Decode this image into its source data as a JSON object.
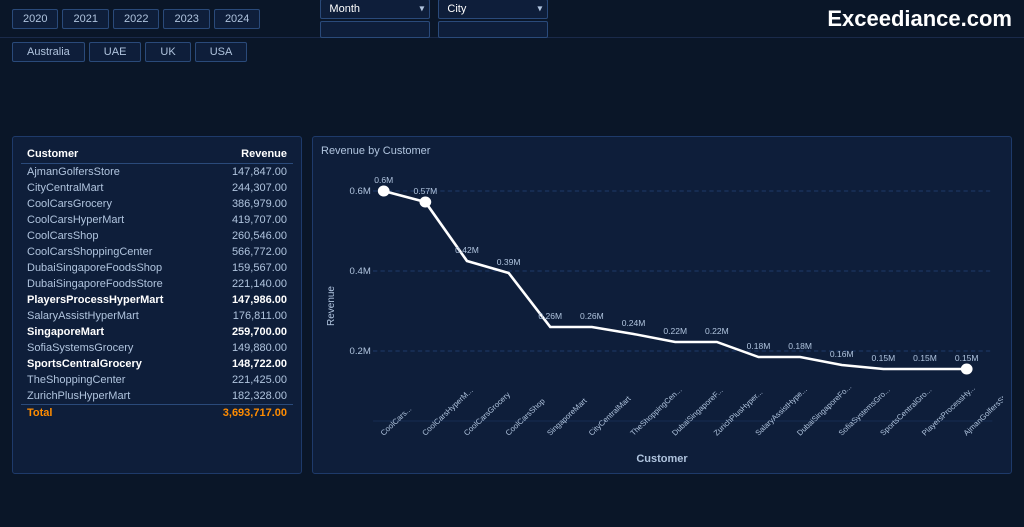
{
  "header": {
    "brand": "Exceediance.com",
    "years": [
      "2020",
      "2021",
      "2022",
      "2023",
      "2024"
    ],
    "month_label": "Month",
    "city_label": "City",
    "month_placeholder": "",
    "city_placeholder": "",
    "countries": [
      "Australia",
      "UAE",
      "UK",
      "USA"
    ]
  },
  "table": {
    "col_customer": "Customer",
    "col_revenue": "Revenue",
    "rows": [
      {
        "name": "AjmanGolfersStore",
        "revenue": "147,847.00",
        "bold": false
      },
      {
        "name": "CityCentralMart",
        "revenue": "244,307.00",
        "bold": false
      },
      {
        "name": "CoolCarsGrocery",
        "revenue": "386,979.00",
        "bold": false
      },
      {
        "name": "CoolCarsHyperMart",
        "revenue": "419,707.00",
        "bold": false
      },
      {
        "name": "CoolCarsShop",
        "revenue": "260,546.00",
        "bold": false
      },
      {
        "name": "CoolCarsShoppingCenter",
        "revenue": "566,772.00",
        "bold": false
      },
      {
        "name": "DubaiSingaporeFoodsShop",
        "revenue": "159,567.00",
        "bold": false
      },
      {
        "name": "DubaiSingaporeFoodsStore",
        "revenue": "221,140.00",
        "bold": false
      },
      {
        "name": "PlayersProcessHyperMart",
        "revenue": "147,986.00",
        "bold": true
      },
      {
        "name": "SalaryAssistHyperMart",
        "revenue": "176,811.00",
        "bold": false
      },
      {
        "name": "SingaporeMart",
        "revenue": "259,700.00",
        "bold": true
      },
      {
        "name": "SofiaSystemsGrocery",
        "revenue": "149,880.00",
        "bold": false
      },
      {
        "name": "SportsCentralGrocery",
        "revenue": "148,722.00",
        "bold": true
      },
      {
        "name": "TheShoppingCenter",
        "revenue": "221,425.00",
        "bold": false
      },
      {
        "name": "ZurichPlusHyperMart",
        "revenue": "182,328.00",
        "bold": false
      }
    ],
    "total_label": "Total",
    "total_value": "3,693,717.00"
  },
  "chart": {
    "title": "Revenue by Customer",
    "y_label": "Revenue",
    "x_label": "Customer",
    "y_ticks": [
      "0.6M",
      "0.4M",
      "0.2M"
    ],
    "data_points": [
      {
        "label": "CoolCars...",
        "value": 0.6,
        "display": "0.6M"
      },
      {
        "label": "CoolCarsHyperM...",
        "value": 0.57,
        "display": "0.57M"
      },
      {
        "label": "CoolCarsGrocery",
        "value": 0.42,
        "display": "0.42M"
      },
      {
        "label": "CoolCarsShop",
        "value": 0.39,
        "display": "0.39M"
      },
      {
        "label": "SingaporeMart",
        "value": 0.26,
        "display": "0.26M"
      },
      {
        "label": "CityCentralMart",
        "value": 0.26,
        "display": "0.26M"
      },
      {
        "label": "TheShoppingCen...",
        "value": 0.24,
        "display": "0.24M"
      },
      {
        "label": "DubaiSingaporeF...",
        "value": 0.22,
        "display": "0.22M"
      },
      {
        "label": "ZurichPlusHyper...",
        "value": 0.22,
        "display": "0.22M"
      },
      {
        "label": "SalaryAssistHype...",
        "value": 0.18,
        "display": "0.18M"
      },
      {
        "label": "DubaiSingaporeFo...",
        "value": 0.18,
        "display": "0.18M"
      },
      {
        "label": "SofiaSystemsGro...",
        "value": 0.16,
        "display": "0.16M"
      },
      {
        "label": "SportsCentralGro...",
        "value": 0.15,
        "display": "0.15M"
      },
      {
        "label": "PlayersProcessHy...",
        "value": 0.15,
        "display": "0.15M"
      },
      {
        "label": "AjmanGolfersStore",
        "value": 0.15,
        "display": "0.15M"
      }
    ]
  }
}
